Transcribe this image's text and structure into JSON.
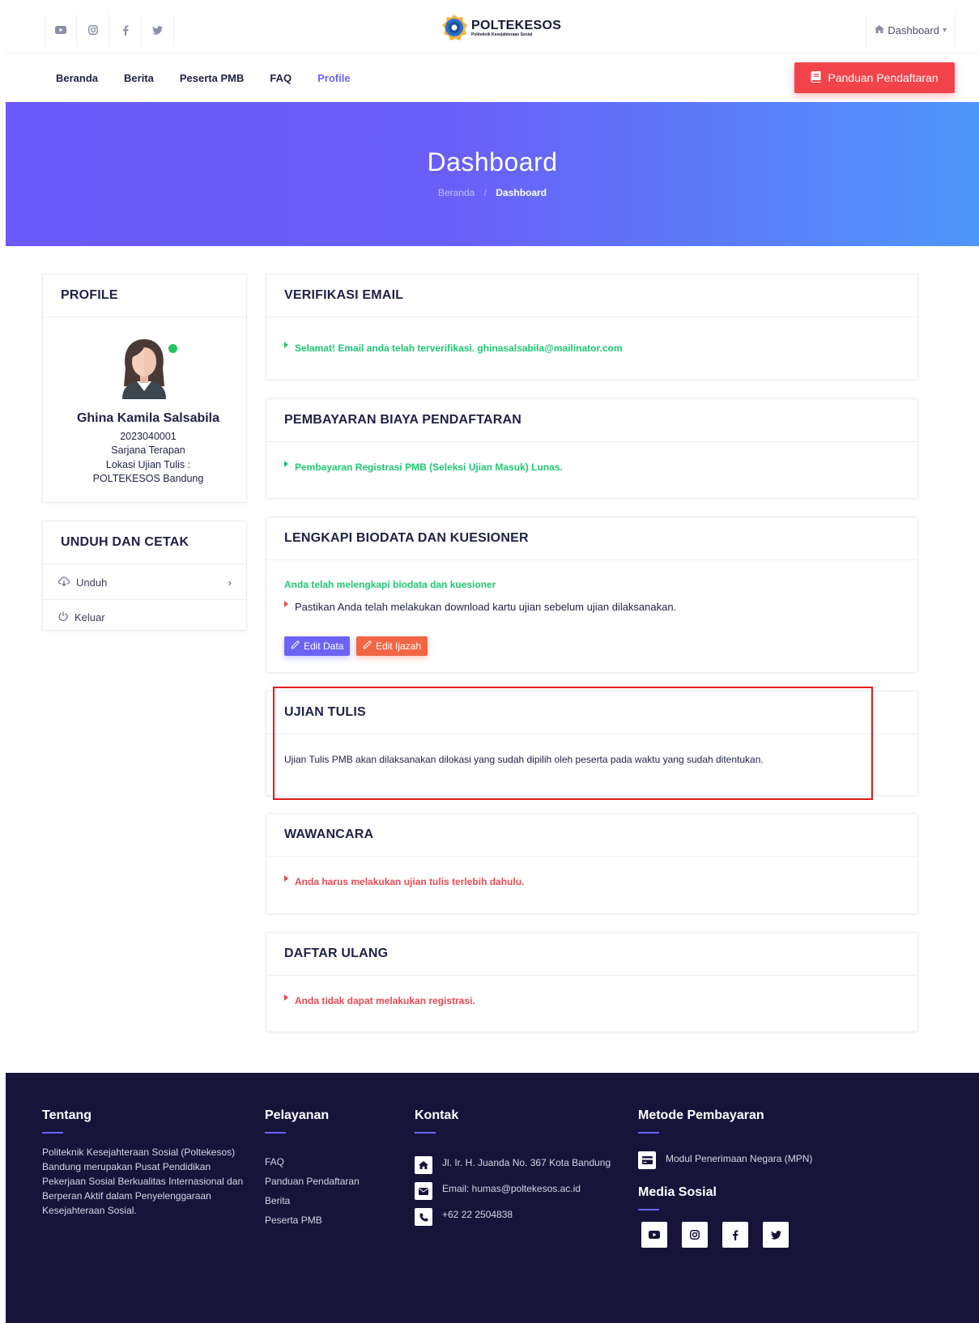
{
  "topbar": {
    "social_icons": [
      "youtube-icon",
      "instagram-icon",
      "facebook-icon",
      "twitter-icon"
    ],
    "logo_title": "POLTEKESOS",
    "logo_subtitle": "Politeknik Kesejahteraan Sosial",
    "dashboard_menu": "Dashboard"
  },
  "nav": {
    "items": [
      "Beranda",
      "Berita",
      "Peserta PMB",
      "FAQ",
      "Profile"
    ],
    "active": "Profile",
    "cta": "Panduan Pendaftaran"
  },
  "hero": {
    "title": "Dashboard",
    "breadcrumb": [
      "Beranda",
      "Dashboard"
    ]
  },
  "profile": {
    "heading": "PROFILE",
    "name": "Ghina Kamila Salsabila",
    "id": "2023040001",
    "program": "Sarjana Terapan",
    "location_label": "Lokasi Ujian Tulis :",
    "location": "POLTEKESOS Bandung"
  },
  "unduh": {
    "heading": "UNDUH DAN CETAK",
    "items": [
      {
        "label": "Unduh",
        "icon": "cloud-download-icon"
      },
      {
        "label": "Keluar",
        "icon": "power-icon"
      }
    ]
  },
  "cards": {
    "verifikasi": {
      "title": "VERIFIKASI EMAIL",
      "message": "Selamat! Email anda telah terverifikasi. ghinasalsabila@mailinator.com"
    },
    "pembayaran": {
      "title": "PEMBAYARAN BIAYA PENDAFTARAN",
      "message": "Pembayaran Registrasi PMB (Seleksi Ujian Masuk) Lunas."
    },
    "biodata": {
      "title": "LENGKAPI BIODATA DAN KUESIONER",
      "status": "Anda telah melengkapi biodata dan kuesioner",
      "note": "Pastikan Anda telah melakukan download kartu ujian sebelum ujian dilaksanakan.",
      "btn_edit_data": "Edit Data",
      "btn_edit_ijazah": "Edit Ijazah"
    },
    "ujian": {
      "title": "UJIAN TULIS",
      "message": "Ujian Tulis PMB akan dilaksanakan dilokasi yang sudah dipilih oleh peserta pada waktu yang sudah ditentukan."
    },
    "wawancara": {
      "title": "WAWANCARA",
      "message": "Anda harus melakukan ujian tulis terlebih dahulu."
    },
    "daftar_ulang": {
      "title": "DAFTAR ULANG",
      "message": "Anda tidak dapat melakukan registrasi."
    }
  },
  "footer": {
    "tentang": {
      "heading": "Tentang",
      "lines": [
        "Politeknik Kesejahteraan Sosial (Poltekesos)",
        "Bandung merupakan Pusat Pendidikan",
        "Pekerjaan Sosial Berkualitas Internasional dan",
        "Berperan Aktif dalam Penyelenggaraan",
        "Kesejahteraan Sosial."
      ]
    },
    "pelayanan": {
      "heading": "Pelayanan",
      "links": [
        "FAQ",
        "Panduan Pendaftaran",
        "Berita",
        "Peserta PMB"
      ]
    },
    "kontak": {
      "heading": "Kontak",
      "address": "Jl. Ir. H. Juanda No. 367 Kota Bandung",
      "email": "Email: humas@poltekesos.ac.id",
      "phone": "+62 22 2504838"
    },
    "metode": {
      "heading": "Metode Pembayaran",
      "item": "Modul Penerimaan Negara (MPN)"
    },
    "media": {
      "heading": "Media Sosial",
      "icons": [
        "youtube-icon",
        "instagram-icon",
        "facebook-icon",
        "twitter-icon"
      ]
    }
  },
  "colors": {
    "accent": "#6b63f6",
    "cta_red": "#f2434a",
    "success": "#1ec774",
    "danger": "#e94952",
    "footer_bg": "#17143a",
    "highlight_border": "#e21b1b"
  }
}
